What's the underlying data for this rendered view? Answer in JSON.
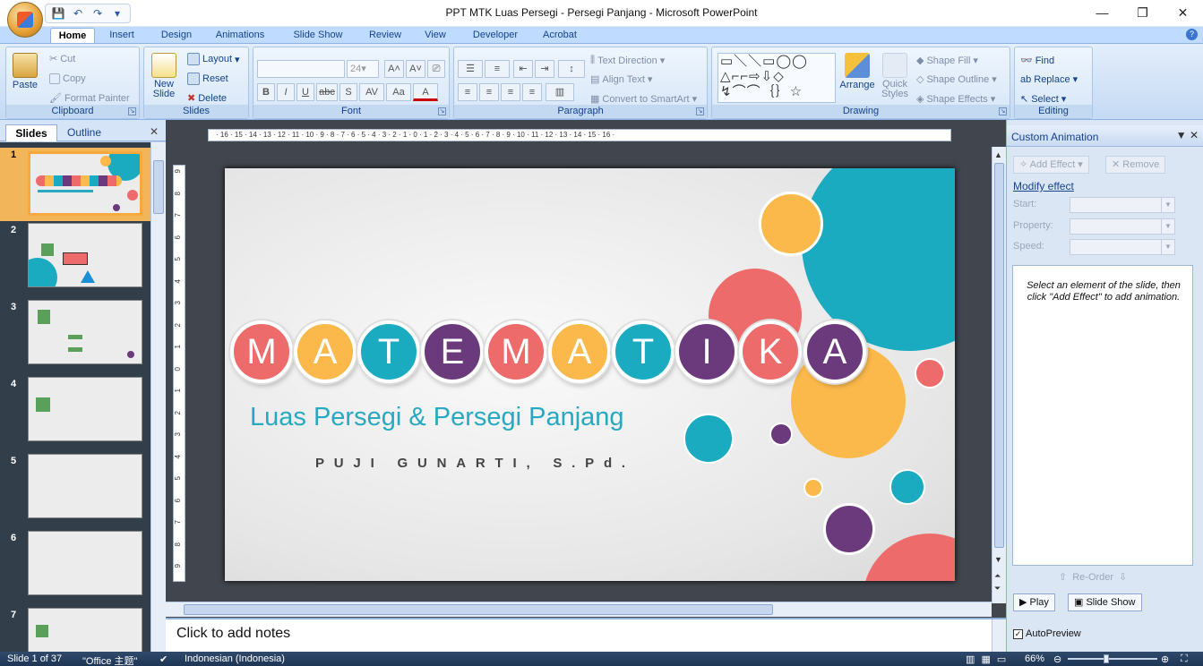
{
  "window": {
    "title": "PPT MTK Luas Persegi - Persegi Panjang - Microsoft PowerPoint",
    "minimize_glyph": "—",
    "restore_glyph": "❐",
    "close_glyph": "✕"
  },
  "ribbon_tabs": [
    "Home",
    "Insert",
    "Design",
    "Animations",
    "Slide Show",
    "Review",
    "View",
    "Developer",
    "Acrobat"
  ],
  "active_tab": "Home",
  "ribbon": {
    "clipboard": {
      "label": "Clipboard",
      "paste": "Paste",
      "cut": "Cut",
      "copy": "Copy",
      "format_painter": "Format Painter"
    },
    "slides": {
      "label": "Slides",
      "new_slide": "New Slide",
      "layout": "Layout",
      "reset": "Reset",
      "delete": "Delete"
    },
    "font": {
      "label": "Font",
      "size": "24"
    },
    "paragraph": {
      "label": "Paragraph",
      "text_direction": "Text Direction",
      "align_text": "Align Text",
      "convert_smartart": "Convert to SmartArt"
    },
    "drawing": {
      "label": "Drawing",
      "arrange": "Arrange",
      "quick_styles": "Quick Styles",
      "shape_fill": "Shape Fill",
      "shape_outline": "Shape Outline",
      "shape_effects": "Shape Effects"
    },
    "editing": {
      "label": "Editing",
      "find": "Find",
      "replace": "Replace",
      "select": "Select"
    }
  },
  "left_pane": {
    "tabs": [
      "Slides",
      "Outline"
    ],
    "slide_numbers": [
      "1",
      "2",
      "3",
      "4",
      "5",
      "6",
      "7"
    ]
  },
  "slide": {
    "title_letters": [
      "M",
      "A",
      "T",
      "E",
      "M",
      "A",
      "T",
      "I",
      "K",
      "A"
    ],
    "subtitle": "Luas Persegi & Persegi Panjang",
    "author": "PUJI GUNARTI, S.Pd."
  },
  "ruler": {
    "horizontal": "· 16 · 15 · 14 · 13 · 12 · 11 · 10 · 9 · 8 · 7 · 6 · 5 · 4 · 3 · 2 · 1 · 0 · 1 · 2 · 3 · 4 · 5 · 6 · 7 · 8 · 9 · 10 · 11 · 12 · 13 · 14 · 15 · 16 ·",
    "vertical": [
      "9",
      "8",
      "7",
      "6",
      "5",
      "4",
      "3",
      "2",
      "1",
      "0",
      "1",
      "2",
      "3",
      "4",
      "5",
      "6",
      "7",
      "8",
      "9"
    ]
  },
  "notes": {
    "placeholder": "Click to add notes"
  },
  "animation_pane": {
    "title": "Custom Animation",
    "add_effect": "Add Effect",
    "remove": "Remove",
    "modify_effect": "Modify effect",
    "start_label": "Start:",
    "property_label": "Property:",
    "speed_label": "Speed:",
    "hint": "Select an element of the slide, then click \"Add Effect\" to add animation.",
    "reorder": "Re-Order",
    "play": "Play",
    "slide_show": "Slide Show",
    "autopreview": "AutoPreview"
  },
  "status_bar": {
    "slide_info": "Slide 1 of 37",
    "theme": "\"Office 主题\"",
    "language": "Indonesian (Indonesia)",
    "zoom": "66%"
  },
  "colors": {
    "coral": "#ee6b6b",
    "yellow": "#fbb94b",
    "teal": "#1aabc0",
    "purple": "#6b3a7d",
    "ribbon_bg": "#bfdbff"
  }
}
